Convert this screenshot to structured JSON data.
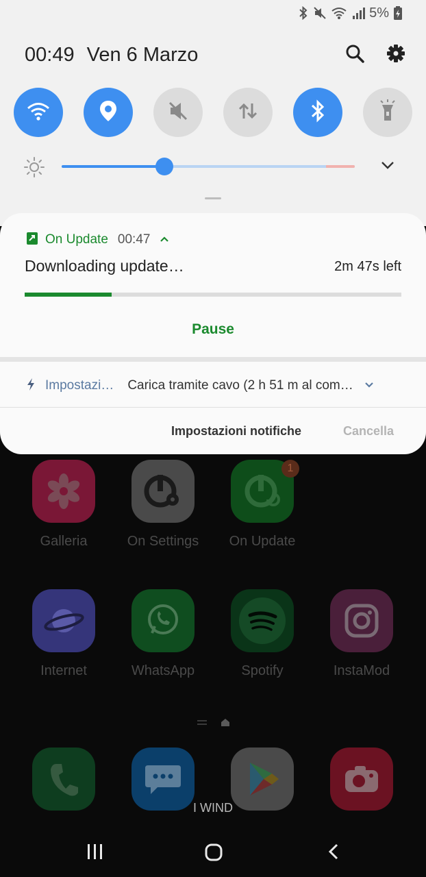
{
  "status_bar": {
    "battery": "5%",
    "icons": [
      "bluetooth-icon",
      "mute-icon",
      "wifi-icon",
      "signal-icon",
      "battery-charging-icon"
    ]
  },
  "panel_header": {
    "time": "00:49",
    "date": "Ven 6 Marzo",
    "actions": [
      "search-icon",
      "settings-icon"
    ]
  },
  "quick_settings": [
    {
      "name": "wifi",
      "state": "on"
    },
    {
      "name": "location",
      "state": "on"
    },
    {
      "name": "sound-mute",
      "state": "off"
    },
    {
      "name": "mobile-data",
      "state": "off"
    },
    {
      "name": "bluetooth",
      "state": "on"
    },
    {
      "name": "flashlight",
      "state": "off"
    }
  ],
  "brightness": {
    "level": 0.35
  },
  "notification": {
    "app_name": "On Update",
    "time": "00:47",
    "title": "Downloading update…",
    "remaining": "2m 47s left",
    "progress": 0.23,
    "action_label": "Pause"
  },
  "charging_notification": {
    "app_name": "Impostazi…",
    "text": "Carica tramite cavo (2 h 51 m al com…"
  },
  "notification_footer": {
    "settings_label": "Impostazioni notifiche",
    "clear_label": "Cancella"
  },
  "home": {
    "row1": [
      {
        "label": "Galleria",
        "icon": "gallery-icon",
        "color": "#7a1736"
      },
      {
        "label": "On Settings",
        "icon": "on-settings-icon",
        "color": "#4a4a4a"
      },
      {
        "label": "On Update",
        "icon": "on-update-icon",
        "color": "#0e4d1a",
        "badge": "1"
      }
    ],
    "row2": [
      {
        "label": "Internet",
        "icon": "internet-icon",
        "color": "#35357a"
      },
      {
        "label": "WhatsApp",
        "icon": "whatsapp-icon",
        "color": "#0f4d1f"
      },
      {
        "label": "Spotify",
        "icon": "spotify-icon",
        "color": "#0a3418"
      },
      {
        "label": "InstaMod",
        "icon": "instamod-icon",
        "color": "#4a1f3a"
      }
    ],
    "dock": [
      {
        "icon": "phone-icon",
        "color": "#0e3d1f"
      },
      {
        "icon": "messages-icon",
        "color": "#0b3f6a"
      },
      {
        "icon": "play-store-icon",
        "color": "#4a4a4a"
      },
      {
        "icon": "camera-icon",
        "color": "#6b1222"
      }
    ],
    "carrier": "I WIND"
  },
  "navbar": [
    "recents-button",
    "home-button",
    "back-button"
  ]
}
